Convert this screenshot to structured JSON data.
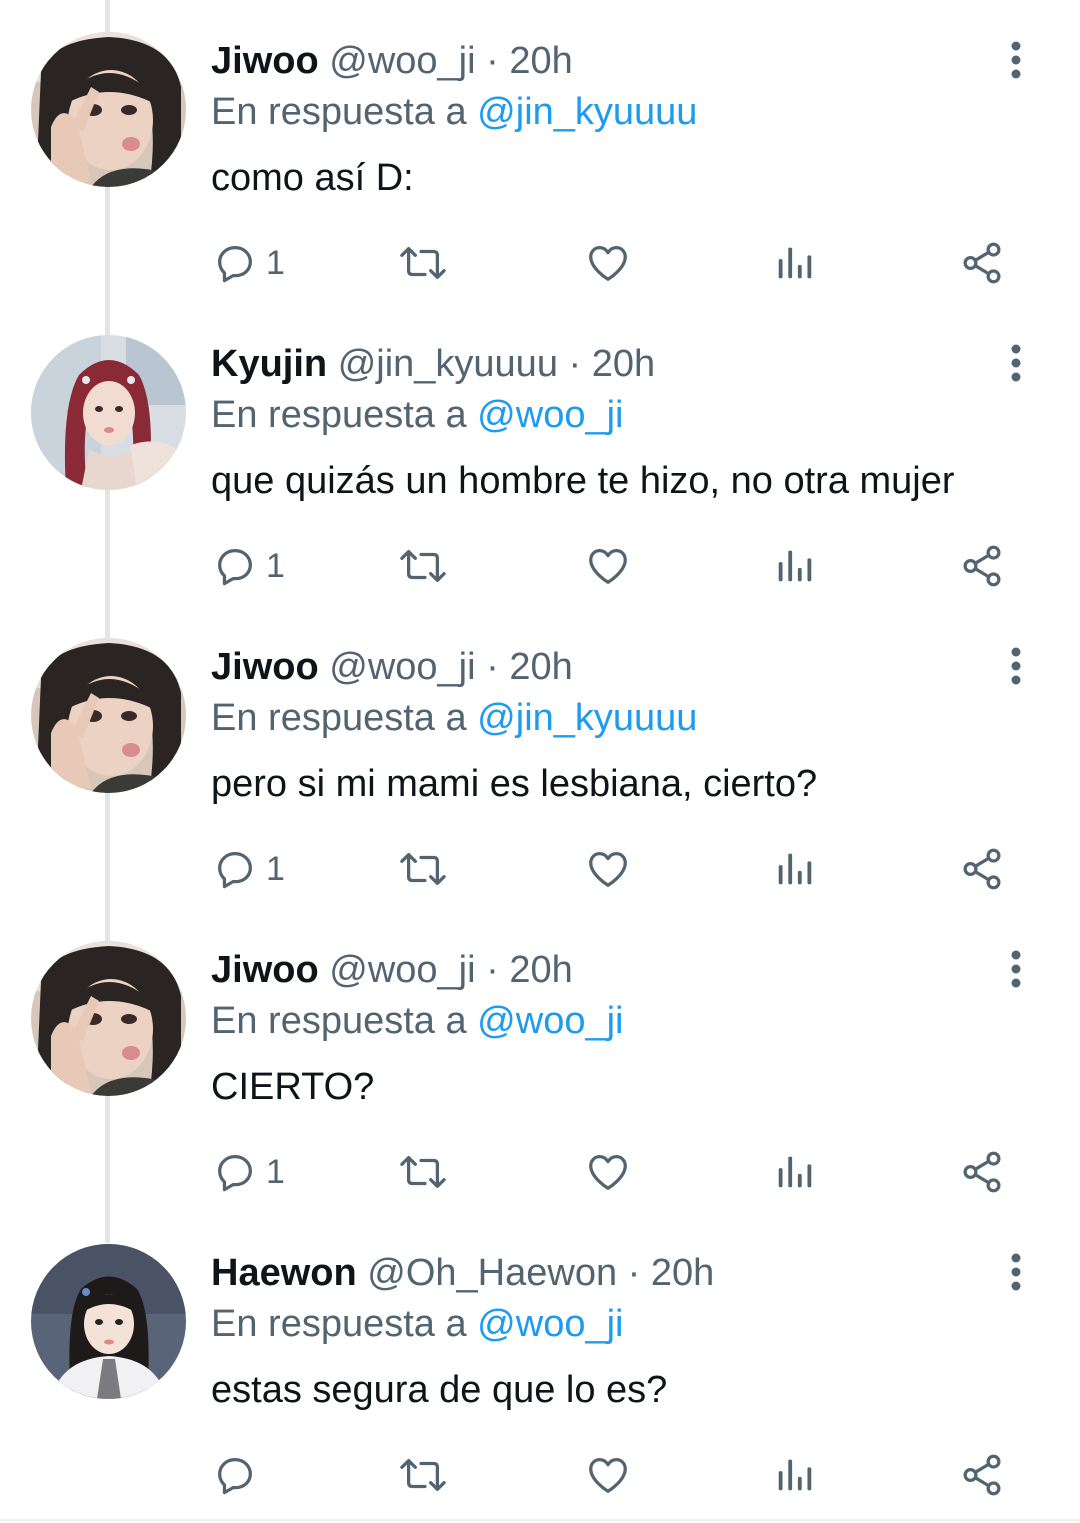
{
  "tweets": [
    {
      "name": "Jiwoo",
      "handle": "@woo_ji",
      "separator": "·",
      "time": "20h",
      "reply_prefix": "En respuesta a",
      "reply_to": "@jin_kyuuuu",
      "text": "como así D:",
      "reply_count": "1",
      "avatar": "jiwoo-avatar"
    },
    {
      "name": "Kyujin",
      "handle": "@jin_kyuuuu",
      "separator": "·",
      "time": "20h",
      "reply_prefix": "En respuesta a",
      "reply_to": "@woo_ji",
      "text": "que quizás un hombre te hizo, no otra mujer",
      "reply_count": "1",
      "avatar": "kyujin-avatar"
    },
    {
      "name": "Jiwoo",
      "handle": "@woo_ji",
      "separator": "·",
      "time": "20h",
      "reply_prefix": "En respuesta a",
      "reply_to": "@jin_kyuuuu",
      "text": "pero si mi mami es lesbiana, cierto?",
      "reply_count": "1",
      "avatar": "jiwoo-avatar"
    },
    {
      "name": "Jiwoo",
      "handle": "@woo_ji",
      "separator": "·",
      "time": "20h",
      "reply_prefix": "En respuesta a",
      "reply_to": "@woo_ji",
      "text": "CIERTO?",
      "reply_count": "1",
      "avatar": "jiwoo-avatar"
    },
    {
      "name": "Haewon",
      "handle": "@Oh_Haewon",
      "separator": "·",
      "time": "20h",
      "reply_prefix": "En respuesta a",
      "reply_to": "@woo_ji",
      "text": "estas segura de que lo es?",
      "reply_count": "",
      "avatar": "haewon-avatar"
    }
  ],
  "icons": {
    "reply": "reply-icon",
    "retweet": "retweet-icon",
    "like": "heart-icon",
    "views": "views-icon",
    "share": "share-icon",
    "more": "more-vertical-icon"
  },
  "colors": {
    "text": "#0f1419",
    "secondary": "#536471",
    "link": "#1d9bf0",
    "thread_line": "#e2e4e7"
  }
}
